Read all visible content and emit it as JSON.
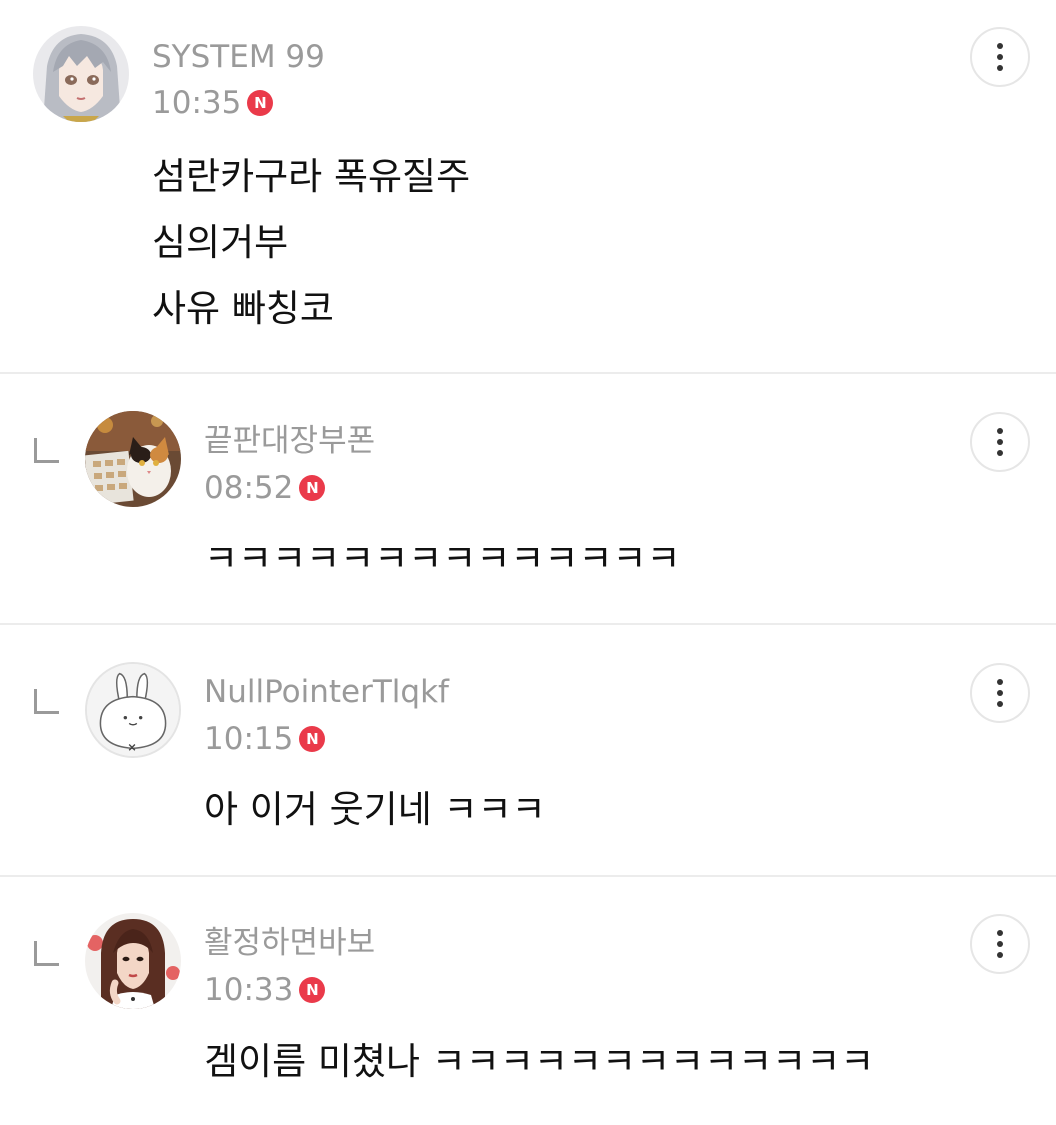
{
  "comments": [
    {
      "username": "SYSTEM 99",
      "time": "10:35",
      "badge": "N",
      "lines": [
        "섬란카구라 폭유질주",
        "심의거부",
        "사유 빠칭코"
      ],
      "avatar": "anime-girl-avatar",
      "is_reply": false
    },
    {
      "username": "끝판대장부폰",
      "time": "08:52",
      "badge": "N",
      "lines": [
        "ㅋㅋㅋㅋㅋㅋㅋㅋㅋㅋㅋㅋㅋㅋ"
      ],
      "avatar": "calico-cat-avatar",
      "is_reply": true
    },
    {
      "username": "NullPointerTlqkf",
      "time": "10:15",
      "badge": "N",
      "lines": [
        "아 이거 웃기네 ㅋㅋㅋ"
      ],
      "avatar": "default-bunny-avatar",
      "is_reply": true
    },
    {
      "username": "활정하면바보",
      "time": "10:33",
      "badge": "N",
      "lines": [
        "겜이름 미쳤나 ㅋㅋㅋㅋㅋㅋㅋㅋㅋㅋㅋㅋㅋ"
      ],
      "avatar": "woman-portrait-avatar",
      "is_reply": true
    }
  ],
  "colors": {
    "badge": "#ea3a4a",
    "meta_text": "#9a9a9a",
    "body_text": "#111111",
    "divider": "#ececec"
  }
}
